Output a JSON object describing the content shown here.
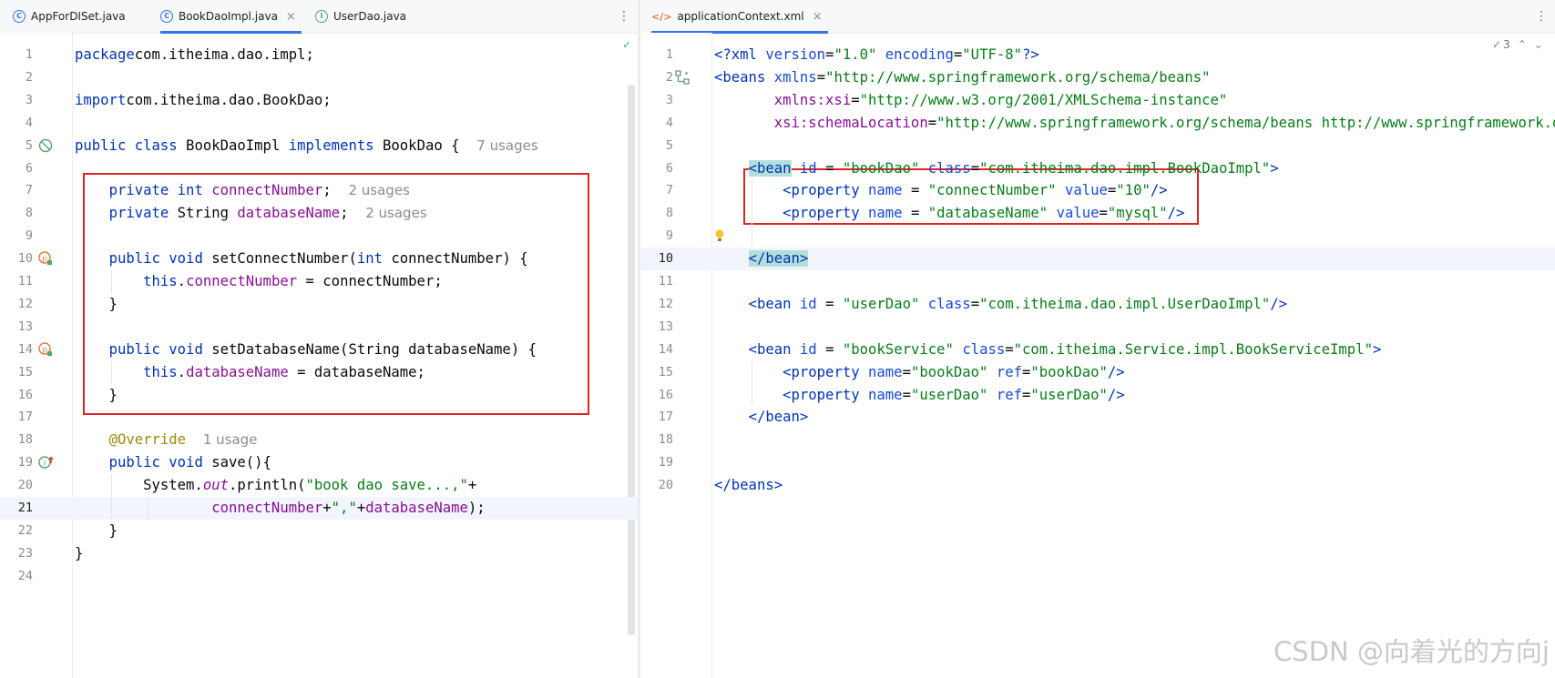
{
  "left_tabs": [
    {
      "label": "AppForDISet.java"
    },
    {
      "label": "BookDaoImpl.java"
    },
    {
      "label": "UserDao.java"
    }
  ],
  "right_tabs": [
    {
      "label": "applicationContext.xml"
    }
  ],
  "kebab_glyph": "⋮",
  "close_glyph": "×",
  "tab_icon_class": "C",
  "tab_icon_interface": "I",
  "tab_icon_xml": "</>",
  "inspection_count": "3",
  "watermark": "CSDN @向着光的方向j",
  "colors": {
    "keyword": "#0033b3",
    "field": "#871094",
    "string": "#067d17",
    "annotation": "#9e880d",
    "highlight_box": "#e02424",
    "tab_underline": "#3574f0"
  },
  "left_lines": [
    {
      "n": "1",
      "segs": [
        [
          "c-kw",
          "package"
        ],
        [
          "",
          "com.itheima.dao.impl;"
        ]
      ]
    },
    {
      "n": "2",
      "segs": []
    },
    {
      "n": "3",
      "segs": [
        [
          "c-kw",
          "import"
        ],
        [
          "",
          "com.itheima.dao.BookDao;"
        ]
      ]
    },
    {
      "n": "4",
      "segs": []
    },
    {
      "n": "5",
      "segs": [
        [
          "c-kw",
          "public class"
        ],
        [
          "",
          " BookDaoImpl "
        ],
        [
          "c-kw",
          "implements"
        ],
        [
          "",
          " BookDao {  "
        ],
        [
          "c-hint",
          "7 usages"
        ]
      ]
    },
    {
      "n": "6",
      "segs": []
    },
    {
      "n": "7",
      "segs": [
        [
          "",
          "    "
        ],
        [
          "c-kw",
          "private int"
        ],
        [
          "",
          " "
        ],
        [
          "c-field",
          "connectNumber"
        ],
        [
          "",
          ";  "
        ],
        [
          "c-hint",
          "2 usages"
        ]
      ]
    },
    {
      "n": "8",
      "segs": [
        [
          "",
          "    "
        ],
        [
          "c-kw",
          "private"
        ],
        [
          "",
          " String "
        ],
        [
          "c-field",
          "databaseName"
        ],
        [
          "",
          ";  "
        ],
        [
          "c-hint",
          "2 usages"
        ]
      ]
    },
    {
      "n": "9",
      "segs": []
    },
    {
      "n": "10",
      "segs": [
        [
          "",
          "    "
        ],
        [
          "c-kw",
          "public void"
        ],
        [
          "",
          " setConnectNumber("
        ],
        [
          "c-kw",
          "int"
        ],
        [
          "",
          " connectNumber) {"
        ]
      ]
    },
    {
      "n": "11",
      "segs": [
        [
          "",
          "        "
        ],
        [
          "c-kw",
          "this"
        ],
        [
          "",
          "."
        ],
        [
          "c-field",
          "connectNumber"
        ],
        [
          "",
          " = connectNumber;"
        ]
      ]
    },
    {
      "n": "12",
      "segs": [
        [
          "",
          "    }"
        ]
      ]
    },
    {
      "n": "13",
      "segs": []
    },
    {
      "n": "14",
      "segs": [
        [
          "",
          "    "
        ],
        [
          "c-kw",
          "public void"
        ],
        [
          "",
          " setDatabaseName(String databaseName) {"
        ]
      ]
    },
    {
      "n": "15",
      "segs": [
        [
          "",
          "        "
        ],
        [
          "c-kw",
          "this"
        ],
        [
          "",
          "."
        ],
        [
          "c-field",
          "databaseName"
        ],
        [
          "",
          " = databaseName;"
        ]
      ]
    },
    {
      "n": "16",
      "segs": [
        [
          "",
          "    }"
        ]
      ]
    },
    {
      "n": "17",
      "segs": []
    },
    {
      "n": "18",
      "segs": [
        [
          "",
          "    "
        ],
        [
          "c-ann",
          "@Override"
        ],
        [
          "",
          "  "
        ],
        [
          "c-hint",
          "1 usage"
        ]
      ]
    },
    {
      "n": "19",
      "segs": [
        [
          "",
          "    "
        ],
        [
          "c-kw",
          "public void"
        ],
        [
          "",
          " save(){"
        ]
      ]
    },
    {
      "n": "20",
      "segs": [
        [
          "",
          "        System."
        ],
        [
          "c-static",
          "out"
        ],
        [
          "",
          ".println("
        ],
        [
          "c-str",
          "\"book dao save...,\""
        ],
        [
          "",
          "+"
        ]
      ]
    },
    {
      "n": "21",
      "segs": [
        [
          "",
          "                "
        ],
        [
          "c-field",
          "connectNumber"
        ],
        [
          "",
          "+"
        ],
        [
          "c-str",
          "\",\""
        ],
        [
          "",
          "+"
        ],
        [
          "c-field",
          "databaseName"
        ],
        [
          "",
          ");"
        ]
      ]
    },
    {
      "n": "22",
      "segs": [
        [
          "",
          "    }"
        ]
      ]
    },
    {
      "n": "23",
      "segs": [
        [
          "",
          "}"
        ]
      ]
    },
    {
      "n": "24",
      "segs": []
    }
  ],
  "right_lines": [
    {
      "n": "1",
      "segs": [
        [
          "x-tag",
          "<?"
        ],
        [
          "x-tag",
          "xml"
        ],
        [
          "",
          " "
        ],
        [
          "x-attr",
          "version"
        ],
        [
          "x-txt",
          "="
        ],
        [
          "x-val",
          "\"1.0\""
        ],
        [
          "",
          " "
        ],
        [
          "x-attr",
          "encoding"
        ],
        [
          "x-txt",
          "="
        ],
        [
          "x-val",
          "\"UTF-8\""
        ],
        [
          "x-tag",
          "?>"
        ]
      ]
    },
    {
      "n": "2",
      "segs": [
        [
          "x-tag",
          "<beans"
        ],
        [
          "",
          " "
        ],
        [
          "x-attr",
          "xmlns"
        ],
        [
          "x-txt",
          "="
        ],
        [
          "x-val",
          "\"http://www.springframework.org/schema/beans\""
        ]
      ]
    },
    {
      "n": "3",
      "segs": [
        [
          "",
          "       "
        ],
        [
          "x-ns",
          "xmlns:xsi"
        ],
        [
          "x-txt",
          "="
        ],
        [
          "x-val",
          "\"http://www.w3.org/2001/XMLSchema-instance\""
        ]
      ]
    },
    {
      "n": "4",
      "segs": [
        [
          "",
          "       "
        ],
        [
          "x-ns",
          "xsi:schemaLocation"
        ],
        [
          "x-txt",
          "="
        ],
        [
          "x-val",
          "\"http://www.springframework.org/schema/beans http://www.springframework.org/schema/beans/spring-beans.xsd\""
        ]
      ]
    },
    {
      "n": "5",
      "segs": []
    },
    {
      "n": "6",
      "segs": [
        [
          "",
          "    "
        ],
        [
          "x-tag x-match",
          "<bean"
        ],
        [
          "",
          " "
        ],
        [
          "x-attr",
          "id"
        ],
        [
          "x-txt",
          " = "
        ],
        [
          "x-val",
          "\"bookDao\""
        ],
        [
          "",
          " "
        ],
        [
          "x-attr",
          "class"
        ],
        [
          "x-txt",
          "="
        ],
        [
          "x-val",
          "\"com.itheima.dao.impl.BookDaoImpl\""
        ],
        [
          "x-tag",
          ">"
        ]
      ]
    },
    {
      "n": "7",
      "segs": [
        [
          "",
          "        "
        ],
        [
          "x-tag",
          "<property"
        ],
        [
          "",
          " "
        ],
        [
          "x-attr",
          "name"
        ],
        [
          "x-txt",
          " = "
        ],
        [
          "x-val",
          "\"connectNumber\""
        ],
        [
          "",
          " "
        ],
        [
          "x-attr",
          "value"
        ],
        [
          "x-txt",
          "="
        ],
        [
          "x-val",
          "\"10\""
        ],
        [
          "x-tag",
          "/>"
        ]
      ]
    },
    {
      "n": "8",
      "segs": [
        [
          "",
          "        "
        ],
        [
          "x-tag",
          "<property"
        ],
        [
          "",
          " "
        ],
        [
          "x-attr",
          "name"
        ],
        [
          "x-txt",
          " = "
        ],
        [
          "x-val",
          "\"databaseName\""
        ],
        [
          "",
          " "
        ],
        [
          "x-attr",
          "value"
        ],
        [
          "x-txt",
          "="
        ],
        [
          "x-val",
          "\"mysql\""
        ],
        [
          "x-tag",
          "/>"
        ]
      ]
    },
    {
      "n": "9",
      "segs": []
    },
    {
      "n": "10",
      "segs": [
        [
          "",
          "    "
        ],
        [
          "x-tag x-match",
          "</bean>"
        ]
      ]
    },
    {
      "n": "11",
      "segs": []
    },
    {
      "n": "12",
      "segs": [
        [
          "",
          "    "
        ],
        [
          "x-tag",
          "<bean"
        ],
        [
          "",
          " "
        ],
        [
          "x-attr",
          "id"
        ],
        [
          "x-txt",
          " = "
        ],
        [
          "x-val",
          "\"userDao\""
        ],
        [
          "",
          " "
        ],
        [
          "x-attr",
          "class"
        ],
        [
          "x-txt",
          "="
        ],
        [
          "x-val",
          "\"com.itheima.dao.impl.UserDaoImpl\""
        ],
        [
          "x-tag",
          "/>"
        ]
      ]
    },
    {
      "n": "13",
      "segs": []
    },
    {
      "n": "14",
      "segs": [
        [
          "",
          "    "
        ],
        [
          "x-tag",
          "<bean"
        ],
        [
          "",
          " "
        ],
        [
          "x-attr",
          "id"
        ],
        [
          "x-txt",
          " = "
        ],
        [
          "x-val",
          "\"bookService\""
        ],
        [
          "",
          " "
        ],
        [
          "x-attr",
          "class"
        ],
        [
          "x-txt",
          "="
        ],
        [
          "x-val",
          "\"com.itheima.Service.impl.BookServiceImpl\""
        ],
        [
          "x-tag",
          ">"
        ]
      ]
    },
    {
      "n": "15",
      "segs": [
        [
          "",
          "        "
        ],
        [
          "x-tag",
          "<property"
        ],
        [
          "",
          " "
        ],
        [
          "x-attr",
          "name"
        ],
        [
          "x-txt",
          "="
        ],
        [
          "x-val",
          "\"bookDao\""
        ],
        [
          "",
          " "
        ],
        [
          "x-attr",
          "ref"
        ],
        [
          "x-txt",
          "="
        ],
        [
          "x-val",
          "\"bookDao\""
        ],
        [
          "x-tag",
          "/>"
        ]
      ]
    },
    {
      "n": "16",
      "segs": [
        [
          "",
          "        "
        ],
        [
          "x-tag",
          "<property"
        ],
        [
          "",
          " "
        ],
        [
          "x-attr",
          "name"
        ],
        [
          "x-txt",
          "="
        ],
        [
          "x-val",
          "\"userDao\""
        ],
        [
          "",
          " "
        ],
        [
          "x-attr",
          "ref"
        ],
        [
          "x-txt",
          "="
        ],
        [
          "x-val",
          "\"userDao\""
        ],
        [
          "x-tag",
          "/>"
        ]
      ]
    },
    {
      "n": "17",
      "segs": [
        [
          "",
          "    "
        ],
        [
          "x-tag",
          "</bean>"
        ]
      ]
    },
    {
      "n": "18",
      "segs": []
    },
    {
      "n": "19",
      "segs": []
    },
    {
      "n": "20",
      "segs": [
        [
          "x-tag",
          "</beans>"
        ]
      ]
    }
  ]
}
